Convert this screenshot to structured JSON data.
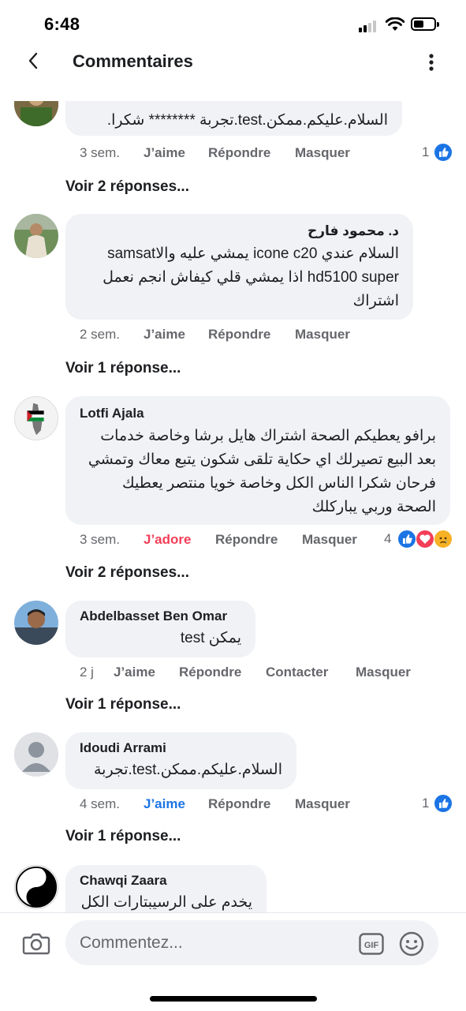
{
  "status_bar": {
    "time": "6:48"
  },
  "header": {
    "title": "Commentaires"
  },
  "comments": [
    {
      "author": "",
      "text": "السلام.عليكم.ممكن.test.تجربة ******** شكرا.",
      "time": "3 sem.",
      "like": "J’aime",
      "reply": "Répondre",
      "hide": "Masquer",
      "reactions_count": "1",
      "replies_link": "Voir 2 réponses..."
    },
    {
      "author": "د. محمود فارح",
      "text": "السلام عندي icone c20 يمشي عليه والاsamsat hd5100 super اذا يمشي قلي كيفاش انجم نعمل اشتراك",
      "time": "2 sem.",
      "like": "J’aime",
      "reply": "Répondre",
      "hide": "Masquer",
      "replies_link": "Voir 1 réponse..."
    },
    {
      "author": "Lotfi Ajala",
      "text": "برافو يعطيكم الصحة اشتراك هايل برشا وخاصة خدمات بعد البيع تصيرلك اي حكاية تلقى شكون يتبع معاك وتمشي فرحان شكرا الناس الكل وخاصة خويا منتصر يعطيك الصحة وربي يباركلك",
      "time": "3 sem.",
      "like": "J’adore",
      "reply": "Répondre",
      "hide": "Masquer",
      "reactions_count": "4",
      "replies_link": "Voir 2 réponses..."
    },
    {
      "author": "Abdelbasset Ben Omar",
      "text": "يمكن test",
      "time": "2 j",
      "like": "J’aime",
      "reply": "Répondre",
      "contact": "Contacter",
      "hide": "Masquer",
      "replies_link": "Voir 1 réponse..."
    },
    {
      "author": "Idoudi Arrami",
      "text": "السلام.عليكم.ممكن.test.تجربة",
      "time": "4 sem.",
      "like": "J’aime",
      "reply": "Répondre",
      "hide": "Masquer",
      "reactions_count": "1",
      "replies_link": "Voir 1 réponse..."
    },
    {
      "author": "Chawqi Zaara",
      "text": "يخدم على الرسيبتارات الكل"
    }
  ],
  "composer": {
    "placeholder": "Commentez..."
  },
  "colors": {
    "accent": "#1b74e4",
    "love": "#f33e58",
    "bubble": "#f0f2f5",
    "muted": "#65676b"
  },
  "icons": {
    "back": "chevron-left-icon",
    "more": "more-vertical-icon",
    "camera": "camera-icon",
    "gif": "gif-icon",
    "emoji": "emoji-icon",
    "like": "thumbs-up-icon",
    "love": "heart-icon",
    "sad": "sad-face-icon"
  }
}
